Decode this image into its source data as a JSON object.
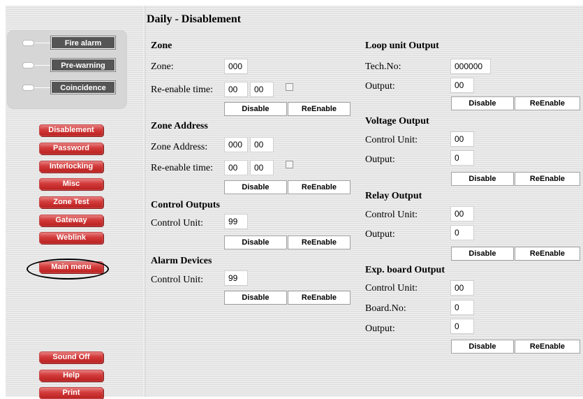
{
  "indicators": {
    "fire_alarm": "Fire alarm",
    "pre_warning": "Pre-warning",
    "coincidence": "Coincidence"
  },
  "menu": {
    "disablement": "Disablement",
    "password": "Password",
    "interlocking": "Interlocking",
    "misc": "Misc",
    "zone_test": "Zone Test",
    "gateway": "Gateway",
    "weblink": "Weblink",
    "main_menu": "Main menu",
    "sound_off": "Sound Off",
    "help": "Help",
    "print": "Print"
  },
  "page_title": "Daily - Disablement",
  "buttons": {
    "disable": "Disable",
    "reenable": "ReEnable"
  },
  "zone": {
    "title": "Zone",
    "zone_label": "Zone:",
    "zone_value": "000",
    "reenable_label": "Re-enable time:",
    "hour_value": "00",
    "minute_value": "00"
  },
  "zone_address": {
    "title": "Zone Address",
    "address_label": "Zone Address:",
    "zone_value": "000",
    "address_value": "00",
    "reenable_label": "Re-enable time:",
    "hour_value": "00",
    "minute_value": "00"
  },
  "control_outputs": {
    "title": "Control Outputs",
    "cu_label": "Control Unit:",
    "cu_value": "99"
  },
  "alarm_devices": {
    "title": "Alarm Devices",
    "cu_label": "Control Unit:",
    "cu_value": "99"
  },
  "loop_unit_output": {
    "title": "Loop unit Output",
    "tech_label": "Tech.No:",
    "tech_value": "000000",
    "output_label": "Output:",
    "output_value": "00"
  },
  "voltage_output": {
    "title": "Voltage Output",
    "cu_label": "Control Unit:",
    "cu_value": "00",
    "output_label": "Output:",
    "output_value": "0"
  },
  "relay_output": {
    "title": "Relay Output",
    "cu_label": "Control Unit:",
    "cu_value": "00",
    "output_label": "Output:",
    "output_value": "0"
  },
  "exp_board_output": {
    "title": "Exp. board Output",
    "cu_label": "Control Unit:",
    "cu_value": "00",
    "board_label": "Board.No:",
    "board_value": "0",
    "output_label": "Output:",
    "output_value": "0"
  }
}
